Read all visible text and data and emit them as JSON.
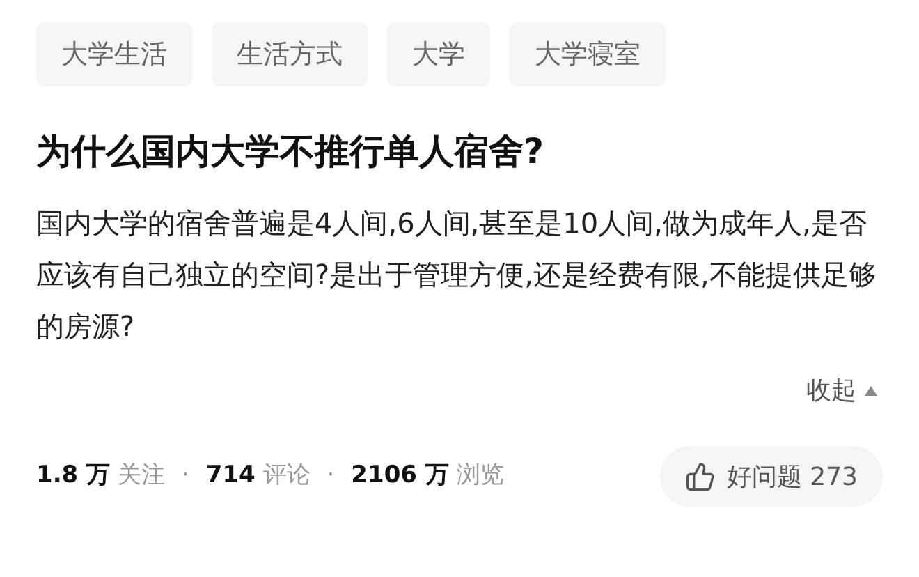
{
  "tags": [
    "大学生活",
    "生活方式",
    "大学",
    "大学寝室"
  ],
  "title": "为什么国内大学不推行单人宿舍?",
  "description": "国内大学的宿舍普遍是4人间,6人间,甚至是10人间,做为成年人,是否应该有自己独立的空间?是出于管理方便,还是经费有限,不能提供足够的房源?",
  "collapse": {
    "label": "收起",
    "expanded": true
  },
  "stats": [
    {
      "count": "1.8 万",
      "label": "关注"
    },
    {
      "count": "714",
      "label": "评论"
    },
    {
      "count": "2106 万",
      "label": "浏览"
    }
  ],
  "separator": "·",
  "good_question": {
    "label": "好问题",
    "count": "273"
  }
}
